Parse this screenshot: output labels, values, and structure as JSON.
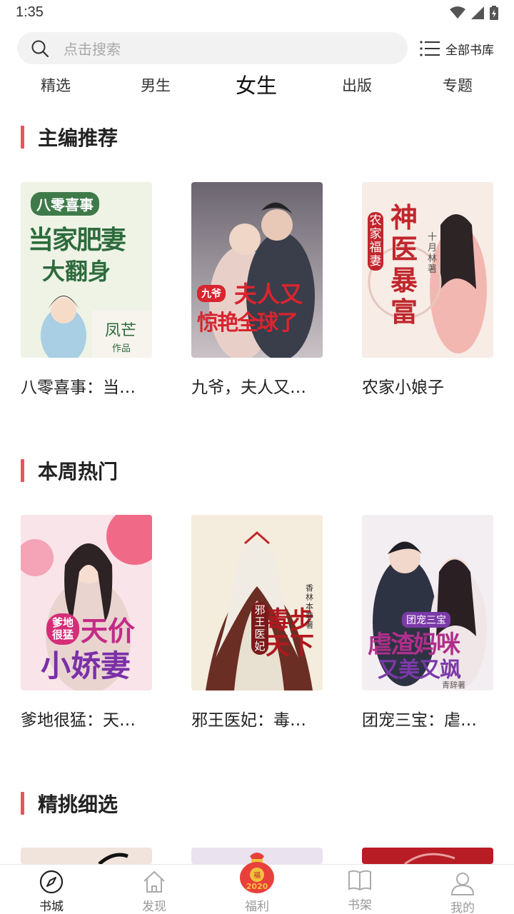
{
  "status_bar": {
    "time": "1:35"
  },
  "search": {
    "placeholder": "点击搜索"
  },
  "library": {
    "label": "全部书库"
  },
  "tabs": [
    {
      "label": "精选",
      "active": false
    },
    {
      "label": "男生",
      "active": false
    },
    {
      "label": "女生",
      "active": true
    },
    {
      "label": "出版",
      "active": false
    },
    {
      "label": "专题",
      "active": false
    }
  ],
  "sections": [
    {
      "title": "主编推荐",
      "books": [
        {
          "title": "八零喜事：当…",
          "cover_text": [
            "八零喜事",
            "当家肥妻",
            "大翻身",
            "凤芒",
            "作品"
          ]
        },
        {
          "title": "九爷，夫人又…",
          "cover_text": [
            "九爷",
            "夫人又",
            "惊艳全球了"
          ]
        },
        {
          "title": "农家小娘子",
          "cover_text": [
            "农家福妻",
            "神医暴富",
            "十月林著"
          ]
        }
      ]
    },
    {
      "title": "本周热门",
      "books": [
        {
          "title": "爹地很猛：天…",
          "cover_text": [
            "爹地很猛",
            "天价",
            "小娇妻"
          ]
        },
        {
          "title": "邪王医妃：毒…",
          "cover_text": [
            "邪王医妃",
            "毒步天下",
            "香林本尊著"
          ]
        },
        {
          "title": "团宠三宝：虐…",
          "cover_text": [
            "团宠三宝",
            "虐渣妈咪",
            "又美又飒",
            "青辞著"
          ]
        }
      ]
    },
    {
      "title": "精挑细选",
      "books": []
    }
  ],
  "bottom_nav": [
    {
      "label": "书城",
      "icon": "compass-icon",
      "active": true
    },
    {
      "label": "发现",
      "icon": "home-icon",
      "active": false
    },
    {
      "label": "福利",
      "icon": "gift-bag-icon",
      "active": false
    },
    {
      "label": "书架",
      "icon": "book-icon",
      "active": false
    },
    {
      "label": "我的",
      "icon": "user-icon",
      "active": false
    }
  ],
  "colors": {
    "accent": "#e8555a",
    "search_bg": "#f2f2f2",
    "muted": "#999999"
  }
}
